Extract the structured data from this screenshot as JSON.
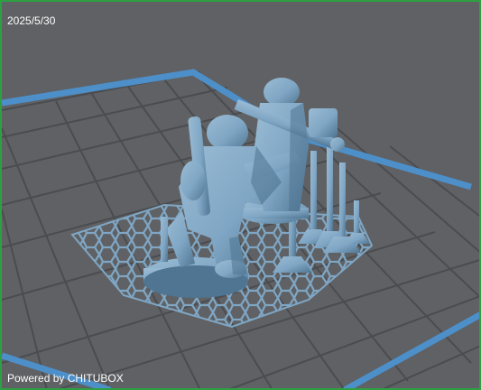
{
  "overlay": {
    "date": "2025/5/30",
    "powered_by": "Powered by CHITUBOX"
  },
  "colors": {
    "background": "#5f6164",
    "grid_line": "#4a4c4f",
    "plate_border": "#4d8fc9",
    "model": "#7fa6c4",
    "model_shadow": "#4f7592",
    "window_border": "#2ea043"
  },
  "icons": {
    "model": "3d-miniature-model",
    "support_lattice": "hexagonal-support-raft"
  }
}
